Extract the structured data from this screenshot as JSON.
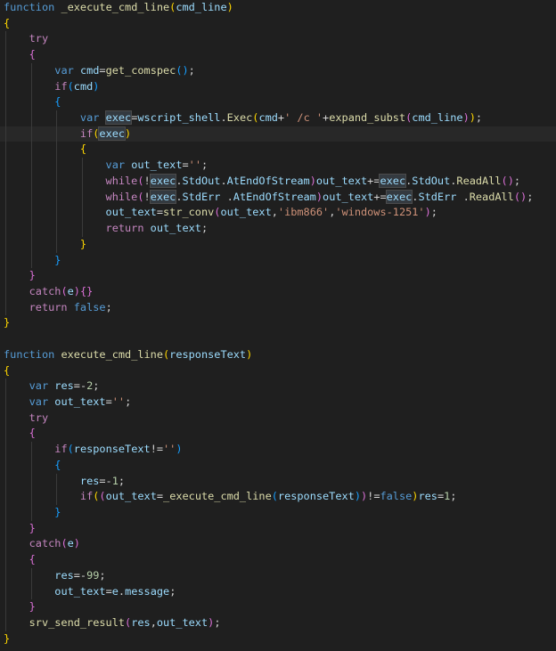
{
  "editor": {
    "lines": [
      {
        "indent": 0,
        "tokens": [
          [
            "keyword",
            "function"
          ],
          [
            "plain",
            " "
          ],
          [
            "func",
            "_execute_cmd_line"
          ],
          [
            "br1",
            "("
          ],
          [
            "var",
            "cmd_line"
          ],
          [
            "br1",
            ")"
          ]
        ]
      },
      {
        "indent": 0,
        "tokens": [
          [
            "br1",
            "{"
          ]
        ]
      },
      {
        "indent": 1,
        "tokens": [
          [
            "control",
            "try"
          ]
        ]
      },
      {
        "indent": 1,
        "tokens": [
          [
            "br2",
            "{"
          ]
        ]
      },
      {
        "indent": 2,
        "tokens": [
          [
            "keyword",
            "var"
          ],
          [
            "plain",
            " "
          ],
          [
            "var",
            "cmd"
          ],
          [
            "plain",
            "="
          ],
          [
            "func",
            "get_comspec"
          ],
          [
            "br3",
            "()"
          ],
          [
            "plain",
            ";"
          ]
        ]
      },
      {
        "indent": 2,
        "tokens": [
          [
            "control",
            "if"
          ],
          [
            "br3",
            "("
          ],
          [
            "var",
            "cmd"
          ],
          [
            "br3",
            ")"
          ]
        ]
      },
      {
        "indent": 2,
        "tokens": [
          [
            "br3",
            "{"
          ]
        ]
      },
      {
        "indent": 3,
        "tokens": [
          [
            "keyword",
            "var"
          ],
          [
            "plain",
            " "
          ],
          [
            "var",
            "exec",
            "hilite"
          ],
          [
            "plain",
            "="
          ],
          [
            "var",
            "wscript_shell"
          ],
          [
            "plain",
            "."
          ],
          [
            "func",
            "Exec"
          ],
          [
            "br1",
            "("
          ],
          [
            "var",
            "cmd"
          ],
          [
            "plain",
            "+"
          ],
          [
            "str",
            "' /c '"
          ],
          [
            "plain",
            "+"
          ],
          [
            "func",
            "expand_subst"
          ],
          [
            "br2",
            "("
          ],
          [
            "var",
            "cmd_line"
          ],
          [
            "br2",
            ")"
          ],
          [
            "br1",
            ")"
          ],
          [
            "plain",
            ";"
          ]
        ]
      },
      {
        "indent": 3,
        "hl": true,
        "tokens": [
          [
            "control",
            "if"
          ],
          [
            "br1",
            "("
          ],
          [
            "var",
            "exec",
            "hilite"
          ],
          [
            "br1",
            ")"
          ]
        ]
      },
      {
        "indent": 3,
        "tokens": [
          [
            "br1",
            "{"
          ]
        ]
      },
      {
        "indent": 4,
        "tokens": [
          [
            "keyword",
            "var"
          ],
          [
            "plain",
            " "
          ],
          [
            "var",
            "out_text"
          ],
          [
            "plain",
            "="
          ],
          [
            "str",
            "''"
          ],
          [
            "plain",
            ";"
          ]
        ]
      },
      {
        "indent": 4,
        "tokens": [
          [
            "control",
            "while"
          ],
          [
            "br2",
            "("
          ],
          [
            "plain",
            "!"
          ],
          [
            "var",
            "exec",
            "hilite"
          ],
          [
            "plain",
            "."
          ],
          [
            "var",
            "StdOut"
          ],
          [
            "plain",
            "."
          ],
          [
            "var",
            "AtEndOfStream"
          ],
          [
            "br2",
            ")"
          ],
          [
            "var",
            "out_text"
          ],
          [
            "plain",
            "+="
          ],
          [
            "var",
            "exec",
            "hilite"
          ],
          [
            "plain",
            "."
          ],
          [
            "var",
            "StdOut"
          ],
          [
            "plain",
            "."
          ],
          [
            "func",
            "ReadAll"
          ],
          [
            "br2",
            "()"
          ],
          [
            "plain",
            ";"
          ]
        ]
      },
      {
        "indent": 4,
        "tokens": [
          [
            "control",
            "while"
          ],
          [
            "br2",
            "("
          ],
          [
            "plain",
            "!"
          ],
          [
            "var",
            "exec",
            "hilite"
          ],
          [
            "plain",
            "."
          ],
          [
            "var",
            "StdErr"
          ],
          [
            "plain",
            " ."
          ],
          [
            "var",
            "AtEndOfStream"
          ],
          [
            "br2",
            ")"
          ],
          [
            "var",
            "out_text"
          ],
          [
            "plain",
            "+="
          ],
          [
            "var",
            "exec",
            "hilite"
          ],
          [
            "plain",
            "."
          ],
          [
            "var",
            "StdErr"
          ],
          [
            "plain",
            " ."
          ],
          [
            "func",
            "ReadAll"
          ],
          [
            "br2",
            "()"
          ],
          [
            "plain",
            ";"
          ]
        ]
      },
      {
        "indent": 4,
        "tokens": [
          [
            "var",
            "out_text"
          ],
          [
            "plain",
            "="
          ],
          [
            "func",
            "str_conv"
          ],
          [
            "br2",
            "("
          ],
          [
            "var",
            "out_text"
          ],
          [
            "plain",
            ","
          ],
          [
            "str",
            "'ibm866'"
          ],
          [
            "plain",
            ","
          ],
          [
            "str",
            "'windows-1251'"
          ],
          [
            "br2",
            ")"
          ],
          [
            "plain",
            ";"
          ]
        ]
      },
      {
        "indent": 4,
        "tokens": [
          [
            "control",
            "return"
          ],
          [
            "plain",
            " "
          ],
          [
            "var",
            "out_text"
          ],
          [
            "plain",
            ";"
          ]
        ]
      },
      {
        "indent": 3,
        "tokens": [
          [
            "br1",
            "}"
          ]
        ]
      },
      {
        "indent": 2,
        "tokens": [
          [
            "br3",
            "}"
          ]
        ]
      },
      {
        "indent": 1,
        "tokens": [
          [
            "br2",
            "}"
          ]
        ]
      },
      {
        "indent": 1,
        "tokens": [
          [
            "control",
            "catch"
          ],
          [
            "br2",
            "("
          ],
          [
            "var",
            "e"
          ],
          [
            "br2",
            ")"
          ],
          [
            "br2",
            "{}"
          ]
        ]
      },
      {
        "indent": 1,
        "tokens": [
          [
            "control",
            "return"
          ],
          [
            "plain",
            " "
          ],
          [
            "keyword",
            "false"
          ],
          [
            "plain",
            ";"
          ]
        ]
      },
      {
        "indent": 0,
        "tokens": [
          [
            "br1",
            "}"
          ]
        ]
      },
      {
        "indent": 0,
        "tokens": []
      },
      {
        "indent": 0,
        "tokens": [
          [
            "keyword",
            "function"
          ],
          [
            "plain",
            " "
          ],
          [
            "func",
            "execute_cmd_line"
          ],
          [
            "br1",
            "("
          ],
          [
            "var",
            "responseText"
          ],
          [
            "br1",
            ")"
          ]
        ]
      },
      {
        "indent": 0,
        "tokens": [
          [
            "br1",
            "{"
          ]
        ]
      },
      {
        "indent": 1,
        "tokens": [
          [
            "keyword",
            "var"
          ],
          [
            "plain",
            " "
          ],
          [
            "var",
            "res"
          ],
          [
            "plain",
            "=-"
          ],
          [
            "num",
            "2"
          ],
          [
            "plain",
            ";"
          ]
        ]
      },
      {
        "indent": 1,
        "tokens": [
          [
            "keyword",
            "var"
          ],
          [
            "plain",
            " "
          ],
          [
            "var",
            "out_text"
          ],
          [
            "plain",
            "="
          ],
          [
            "str",
            "''"
          ],
          [
            "plain",
            ";"
          ]
        ]
      },
      {
        "indent": 1,
        "tokens": [
          [
            "control",
            "try"
          ]
        ]
      },
      {
        "indent": 1,
        "tokens": [
          [
            "br2",
            "{"
          ]
        ]
      },
      {
        "indent": 2,
        "tokens": [
          [
            "control",
            "if"
          ],
          [
            "br3",
            "("
          ],
          [
            "var",
            "responseText"
          ],
          [
            "plain",
            "!="
          ],
          [
            "str",
            "''"
          ],
          [
            "br3",
            ")"
          ]
        ]
      },
      {
        "indent": 2,
        "tokens": [
          [
            "br3",
            "{"
          ]
        ]
      },
      {
        "indent": 3,
        "tokens": [
          [
            "var",
            "res"
          ],
          [
            "plain",
            "=-"
          ],
          [
            "num",
            "1"
          ],
          [
            "plain",
            ";"
          ]
        ]
      },
      {
        "indent": 3,
        "tokens": [
          [
            "control",
            "if"
          ],
          [
            "br1",
            "("
          ],
          [
            "br2",
            "("
          ],
          [
            "var",
            "out_text"
          ],
          [
            "plain",
            "="
          ],
          [
            "func",
            "_execute_cmd_line"
          ],
          [
            "br3",
            "("
          ],
          [
            "var",
            "responseText"
          ],
          [
            "br3",
            ")"
          ],
          [
            "br2",
            ")"
          ],
          [
            "plain",
            "!="
          ],
          [
            "keyword",
            "false"
          ],
          [
            "br1",
            ")"
          ],
          [
            "var",
            "res"
          ],
          [
            "plain",
            "="
          ],
          [
            "num",
            "1"
          ],
          [
            "plain",
            ";"
          ]
        ]
      },
      {
        "indent": 2,
        "tokens": [
          [
            "br3",
            "}"
          ]
        ]
      },
      {
        "indent": 1,
        "tokens": [
          [
            "br2",
            "}"
          ]
        ]
      },
      {
        "indent": 1,
        "tokens": [
          [
            "control",
            "catch"
          ],
          [
            "br2",
            "("
          ],
          [
            "var",
            "e"
          ],
          [
            "br2",
            ")"
          ]
        ]
      },
      {
        "indent": 1,
        "tokens": [
          [
            "br2",
            "{"
          ]
        ]
      },
      {
        "indent": 2,
        "tokens": [
          [
            "var",
            "res"
          ],
          [
            "plain",
            "=-"
          ],
          [
            "num",
            "99"
          ],
          [
            "plain",
            ";"
          ]
        ]
      },
      {
        "indent": 2,
        "tokens": [
          [
            "var",
            "out_text"
          ],
          [
            "plain",
            "="
          ],
          [
            "var",
            "e"
          ],
          [
            "plain",
            "."
          ],
          [
            "var",
            "message"
          ],
          [
            "plain",
            ";"
          ]
        ]
      },
      {
        "indent": 1,
        "tokens": [
          [
            "br2",
            "}"
          ]
        ]
      },
      {
        "indent": 1,
        "tokens": [
          [
            "func",
            "srv_send_result"
          ],
          [
            "br2",
            "("
          ],
          [
            "var",
            "res"
          ],
          [
            "plain",
            ","
          ],
          [
            "var",
            "out_text"
          ],
          [
            "br2",
            ")"
          ],
          [
            "plain",
            ";"
          ]
        ]
      },
      {
        "indent": 0,
        "tokens": [
          [
            "br1",
            "}"
          ]
        ]
      }
    ]
  },
  "colors": {
    "background": "#1f1f1f",
    "keyword": "#569cd6",
    "control": "#c586c0",
    "function": "#dcdcaa",
    "variable": "#9cdcfe",
    "string": "#ce9178",
    "number": "#b5cea8",
    "bracket_level1": "#ffd700",
    "bracket_level2": "#da70d6",
    "bracket_level3": "#179fff"
  }
}
